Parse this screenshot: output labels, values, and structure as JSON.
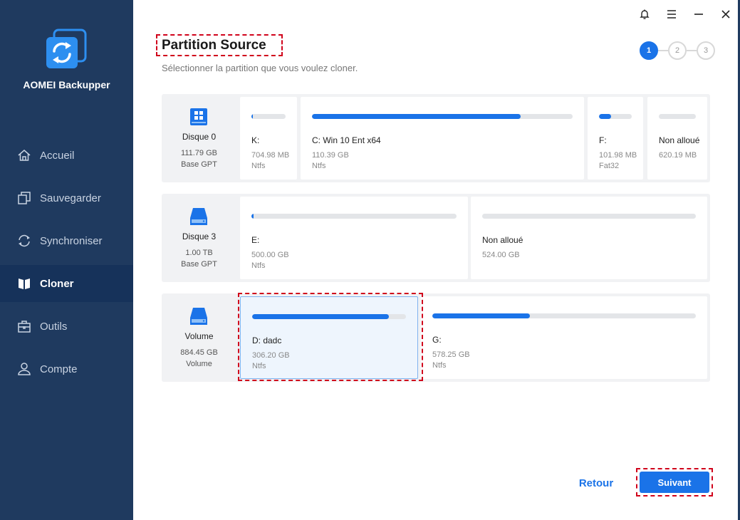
{
  "app": {
    "name": "AOMEI Backupper"
  },
  "nav": [
    {
      "label": "Accueil",
      "icon": "home-icon"
    },
    {
      "label": "Sauvegarder",
      "icon": "backup-icon"
    },
    {
      "label": "Synchroniser",
      "icon": "sync-icon"
    },
    {
      "label": "Cloner",
      "icon": "clone-icon",
      "active": true
    },
    {
      "label": "Outils",
      "icon": "tools-icon"
    },
    {
      "label": "Compte",
      "icon": "user-icon"
    }
  ],
  "header": {
    "title": "Partition Source",
    "subtitle": "Sélectionner la partition que vous voulez cloner."
  },
  "steps": [
    {
      "label": "1",
      "active": true
    },
    {
      "label": "2",
      "active": false
    },
    {
      "label": "3",
      "active": false
    }
  ],
  "disks": [
    {
      "name": "Disque 0",
      "size": "111.79 GB",
      "type": "Base GPT",
      "partitions": [
        {
          "name": "K:",
          "size": "704.98 MB",
          "fs": "Ntfs",
          "used": 0.05
        },
        {
          "name": "C: Win 10 Ent x64",
          "size": "110.39 GB",
          "fs": "Ntfs",
          "used": 0.8
        },
        {
          "name": "F:",
          "size": "101.98 MB",
          "fs": "Fat32",
          "used": 0.38
        },
        {
          "name": "Non alloué",
          "size": "620.19 MB",
          "fs": "",
          "used": 0
        }
      ]
    },
    {
      "name": "Disque 3",
      "size": "1.00 TB",
      "type": "Base GPT",
      "partitions": [
        {
          "name": "E:",
          "size": "500.00 GB",
          "fs": "Ntfs",
          "used": 0.01
        },
        {
          "name": "Non alloué",
          "size": "524.00 GB",
          "fs": "",
          "used": 0
        }
      ]
    },
    {
      "name": "Volume",
      "size": "884.45 GB",
      "type": "Volume",
      "partitions": [
        {
          "name": "D: dadc",
          "size": "306.20 GB",
          "fs": "Ntfs",
          "used": 0.89,
          "selected": true
        },
        {
          "name": "G:",
          "size": "578.25 GB",
          "fs": "Ntfs",
          "used": 0.37
        }
      ]
    }
  ],
  "buttons": {
    "back": "Retour",
    "next": "Suivant"
  },
  "colors": {
    "sidebar": "#1f3a5f",
    "accent": "#1a73e8",
    "highlight": "#d0021b"
  }
}
